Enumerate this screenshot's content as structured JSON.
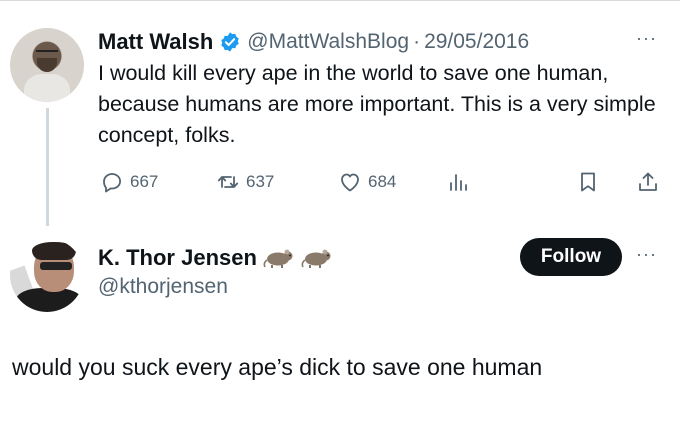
{
  "parent_tweet": {
    "author_name": "Matt Walsh",
    "verified": true,
    "handle": "@MattWalshBlog",
    "separator": "·",
    "date": "29/05/2016",
    "more": "···",
    "text": "I would kill every ape in the world to save one human, because humans are more important. This is a very simple concept, folks.",
    "actions": {
      "replies": "667",
      "retweets": "637",
      "likes": "684"
    }
  },
  "reply_tweet": {
    "author_name": "K. Thor Jensen",
    "handle": "@kthorjensen",
    "follow_label": "Follow",
    "more": "···",
    "text": "would you suck every ape’s dick to save one human"
  },
  "colors": {
    "text": "#0f1419",
    "secondary": "#536471",
    "verified": "#1d9bf0",
    "follow_bg": "#0f1419",
    "thread_line": "#cfd9de"
  }
}
